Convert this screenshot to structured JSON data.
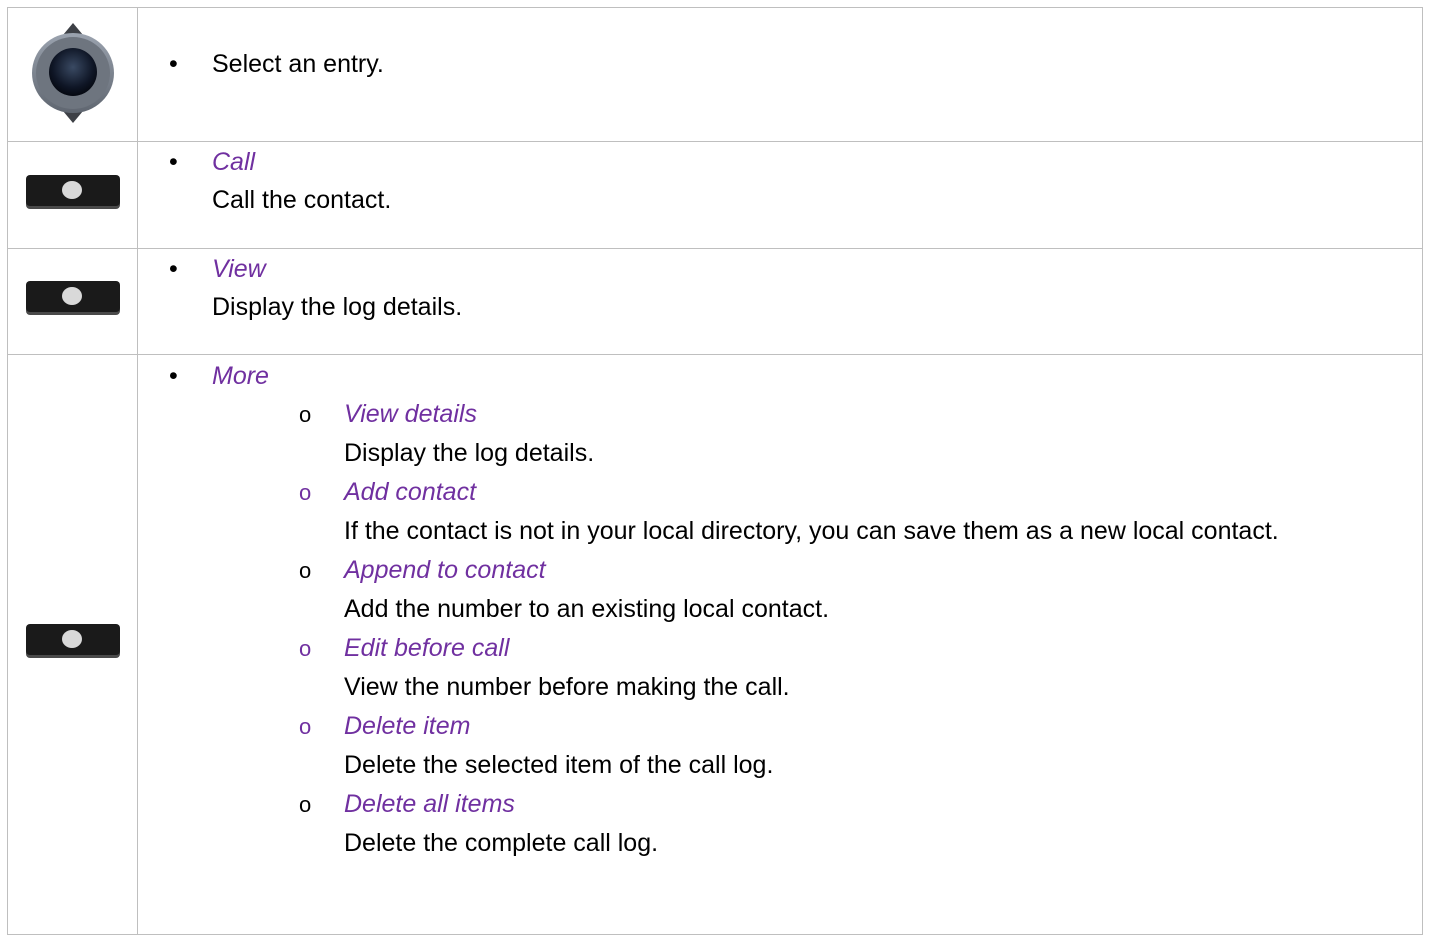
{
  "rows": [
    {
      "icon": "navigation-key-icon",
      "text": "Select an entry."
    },
    {
      "icon": "softkey-icon",
      "label": "Call",
      "description": "Call the contact."
    },
    {
      "icon": "softkey-icon",
      "label": "View",
      "description": "Display the log details."
    },
    {
      "icon": "softkey-icon",
      "label": "More",
      "sub_items": [
        {
          "bullet": "o",
          "label": "View details",
          "description": "Display the log details."
        },
        {
          "bullet": "o",
          "label": "Add contact",
          "description": "If the contact is not in your local directory, you can save them as a new local contact."
        },
        {
          "bullet": "o",
          "label": "Append to contact",
          "description": "Add the number to an existing local contact."
        },
        {
          "bullet": "o",
          "label": "Edit before call",
          "description": "View the number before making the call."
        },
        {
          "bullet": "o",
          "label": "Delete item",
          "description": "Delete the selected item of the call log."
        },
        {
          "bullet": "o",
          "label": "Delete all items",
          "description": "Delete the complete call log."
        }
      ]
    }
  ],
  "colors": {
    "label": "#7030a0",
    "text": "#000000",
    "border": "#bfbfbf",
    "softkey_body": "#1a1a1a",
    "softkey_dot": "#d9d9d9"
  }
}
